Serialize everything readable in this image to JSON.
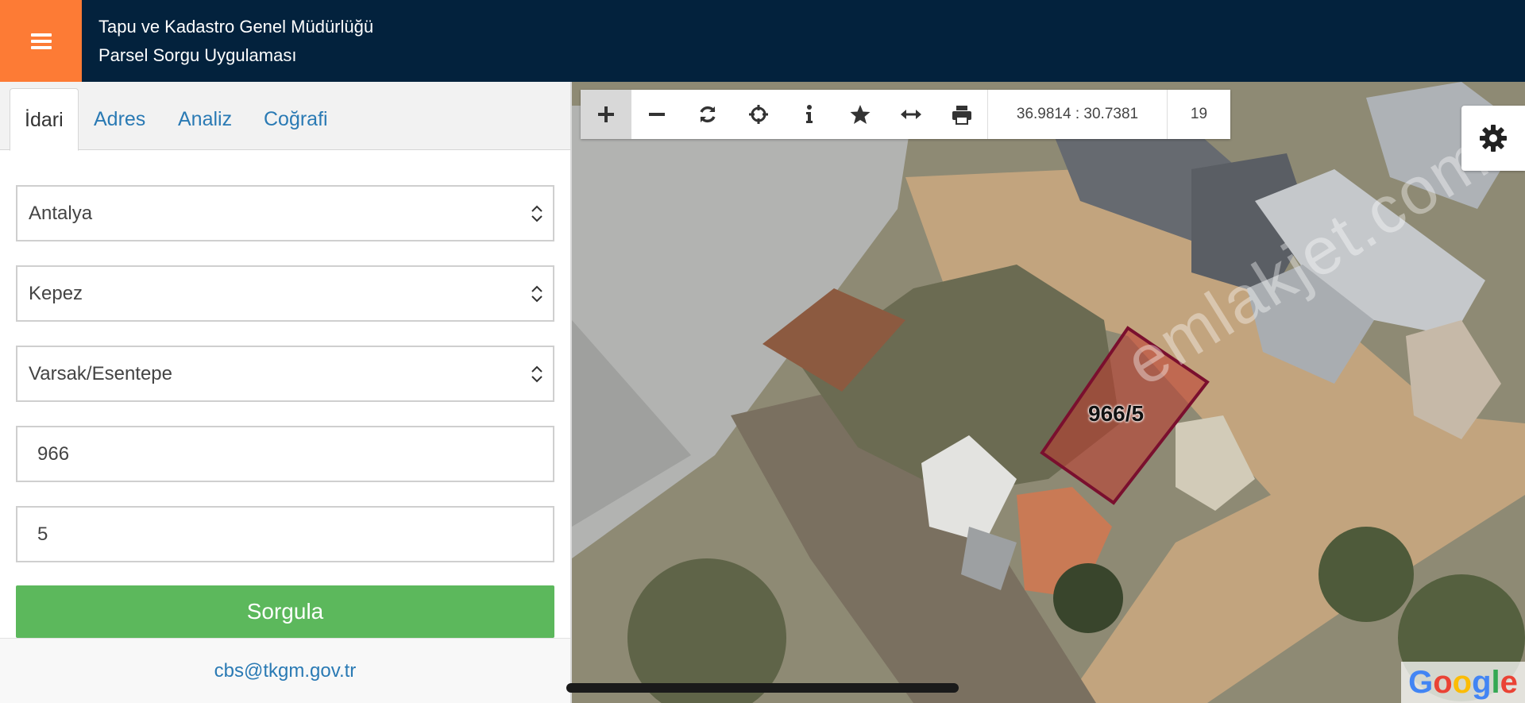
{
  "header": {
    "title_line1": "Tapu ve Kadastro Genel Müdürlüğü",
    "title_line2": "Parsel Sorgu Uygulaması"
  },
  "sidebar": {
    "tabs": [
      {
        "label": "İdari",
        "active": true
      },
      {
        "label": "Adres",
        "active": false
      },
      {
        "label": "Analiz",
        "active": false
      },
      {
        "label": "Coğrafi",
        "active": false
      }
    ],
    "fields": {
      "province": "Antalya",
      "district": "Kepez",
      "neighborhood": "Varsak/Esentepe",
      "block": "966",
      "parcel": "5"
    },
    "submit_label": "Sorgula",
    "footer_email": "cbs@tkgm.gov.tr"
  },
  "map": {
    "tools": [
      {
        "name": "zoom-in",
        "icon": "plus-icon"
      },
      {
        "name": "zoom-out",
        "icon": "minus-icon"
      },
      {
        "name": "refresh",
        "icon": "refresh-icon"
      },
      {
        "name": "locate",
        "icon": "crosshair-icon"
      },
      {
        "name": "info",
        "icon": "info-icon"
      },
      {
        "name": "favorite",
        "icon": "star-icon"
      },
      {
        "name": "measure",
        "icon": "arrows-horizontal-icon"
      },
      {
        "name": "print",
        "icon": "print-icon"
      }
    ],
    "coordinates": "36.9814 : 30.7381",
    "zoom_level": "19",
    "parcel_label": "966/5",
    "watermark": "emlakjet.com",
    "attribution": "Google",
    "colors": {
      "parcel_outline": "#7a0f2e",
      "parcel_fill": "#c0392b"
    }
  }
}
